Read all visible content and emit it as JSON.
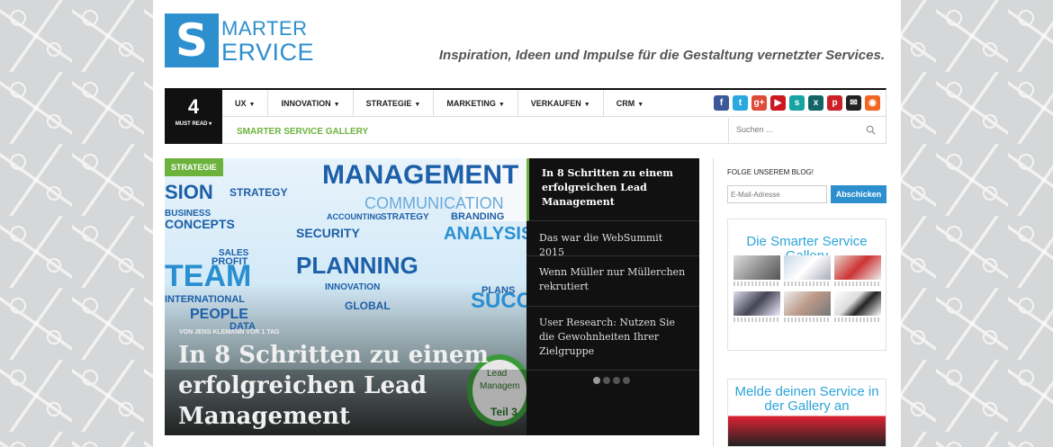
{
  "header": {
    "logo_letter": "S",
    "logo_line1": "MARTER",
    "logo_line2": "ERVICE",
    "tagline": "Inspiration, Ideen und Impulse für die Gestaltung vernetzter Services."
  },
  "nav": {
    "must_read_count": "4",
    "must_read_label": "MUST READ ▾",
    "menu": [
      {
        "label": "UX"
      },
      {
        "label": "INNOVATION"
      },
      {
        "label": "STRATEGIE"
      },
      {
        "label": "MARKETING"
      },
      {
        "label": "VERKAUFEN"
      },
      {
        "label": "CRM"
      }
    ],
    "gallery_link": "SMARTER SERVICE GALLERY",
    "search_placeholder": "Suchen ...",
    "social": [
      {
        "icon": "facebook-icon",
        "glyph": "f",
        "color": "#3b5998"
      },
      {
        "icon": "twitter-icon",
        "glyph": "t",
        "color": "#2aa9e0"
      },
      {
        "icon": "googleplus-icon",
        "glyph": "g+",
        "color": "#dd4b39"
      },
      {
        "icon": "youtube-icon",
        "glyph": "▶",
        "color": "#cc181e"
      },
      {
        "icon": "slideshare-icon",
        "glyph": "s",
        "color": "#18a3a3"
      },
      {
        "icon": "xing-icon",
        "glyph": "x",
        "color": "#126567"
      },
      {
        "icon": "pinterest-icon",
        "glyph": "p",
        "color": "#cb2027"
      },
      {
        "icon": "email-icon",
        "glyph": "✉",
        "color": "#222222"
      },
      {
        "icon": "rss-icon",
        "glyph": "◉",
        "color": "#f26522"
      }
    ]
  },
  "hero": {
    "category": "STRATEGIE",
    "byline": "VON JENS KLEMANN VOR 1 TAG",
    "title": "In 8 Schritten zu einem erfolgreichen Lead Management"
  },
  "articles": [
    {
      "title": "In 8 Schritten zu einem erfolgreichen Lead Management"
    },
    {
      "title": "Das war die WebSummit 2015"
    },
    {
      "title": "Wenn Müller nur Müllerchen rekrutiert"
    },
    {
      "title": "User Research: Nutzen Sie die Gewohnheiten Ihrer Zielgruppe"
    }
  ],
  "sidebar": {
    "follow_label": "FOLGE UNSEREM BLOG!",
    "email_placeholder": "E-Mail-Adresse",
    "subscribe_label": "Abschicken",
    "gallery_title": "Die Smarter Service Gallery",
    "melde_title": "Melde deinen Service in der Gallery an"
  }
}
